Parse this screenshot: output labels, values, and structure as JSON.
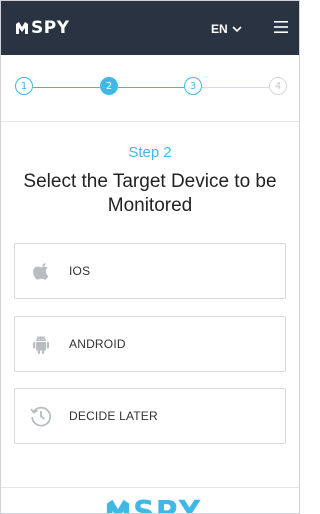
{
  "header": {
    "logo_text": "SPY",
    "language": "EN",
    "bg_color": "#2a3342"
  },
  "stepper": {
    "steps": [
      "1",
      "2",
      "3",
      "4"
    ],
    "current_step": 2,
    "accent_color": "#3fb8e8"
  },
  "main": {
    "step_label": "Step 2",
    "title": "Select the Target Device to be Monitored",
    "options": [
      {
        "label": "IOS",
        "icon": "apple-icon"
      },
      {
        "label": "ANDROID",
        "icon": "android-icon"
      },
      {
        "label": "DECIDE LATER",
        "icon": "clock-icon"
      }
    ]
  },
  "footer": {
    "logo_text": "SPY"
  }
}
